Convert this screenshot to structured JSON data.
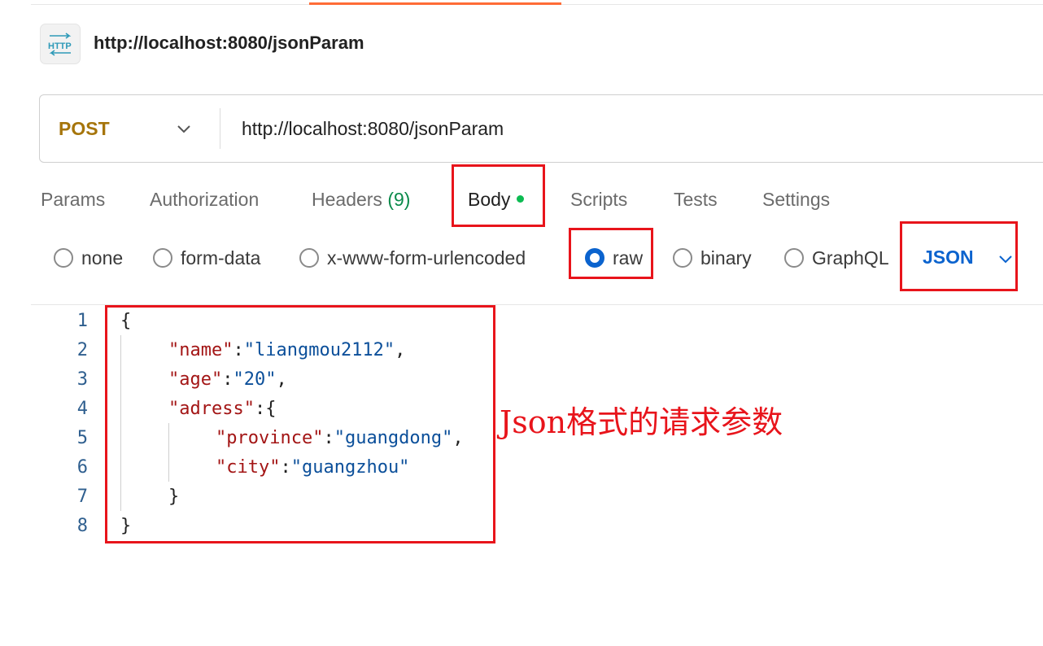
{
  "request": {
    "title": "http://localhost:8080/jsonParam",
    "method": "POST",
    "url": "http://localhost:8080/jsonParam"
  },
  "tabs": [
    {
      "label": "Params"
    },
    {
      "label": "Authorization"
    },
    {
      "label": "Headers",
      "count": "(9)"
    },
    {
      "label": "Body",
      "active": true
    },
    {
      "label": "Scripts"
    },
    {
      "label": "Tests"
    },
    {
      "label": "Settings"
    }
  ],
  "body_types": [
    {
      "label": "none",
      "selected": false
    },
    {
      "label": "form-data",
      "selected": false
    },
    {
      "label": "x-www-form-urlencoded",
      "selected": false
    },
    {
      "label": "raw",
      "selected": true
    },
    {
      "label": "binary",
      "selected": false
    },
    {
      "label": "GraphQL",
      "selected": false
    }
  ],
  "language": "JSON",
  "editor": {
    "line_numbers": [
      "1",
      "2",
      "3",
      "4",
      "5",
      "6",
      "7",
      "8"
    ],
    "lines": [
      "{",
      "\"name\":\"liangmou2112\",",
      "\"age\":\"20\",",
      "\"adress\":{",
      "\"province\":\"guangdong\",",
      "\"city\":\"guangzhou\"",
      "}",
      "}"
    ],
    "tokens": {
      "brace_open": "{",
      "brace_close": "}",
      "k_name": "\"name\"",
      "v_name": "\"liangmou2112\"",
      "k_age": "\"age\"",
      "v_age": "\"20\"",
      "k_adress": "\"adress\"",
      "k_province": "\"province\"",
      "v_province": "\"guangdong\"",
      "k_city": "\"city\"",
      "v_city": "\"guangzhou\"",
      "colon": ":",
      "comma": ","
    }
  },
  "annotation": "Json格式的请求参数",
  "colors": {
    "method": "#a6750b",
    "accent_blue": "#0b63ce",
    "annotation_red": "#e8141b",
    "json_key": "#a31515",
    "json_string": "#0b4f9a"
  },
  "icons": {
    "request_type": "http-icon",
    "method_dropdown": "chevron-down-icon",
    "language_dropdown": "chevron-down-icon"
  }
}
